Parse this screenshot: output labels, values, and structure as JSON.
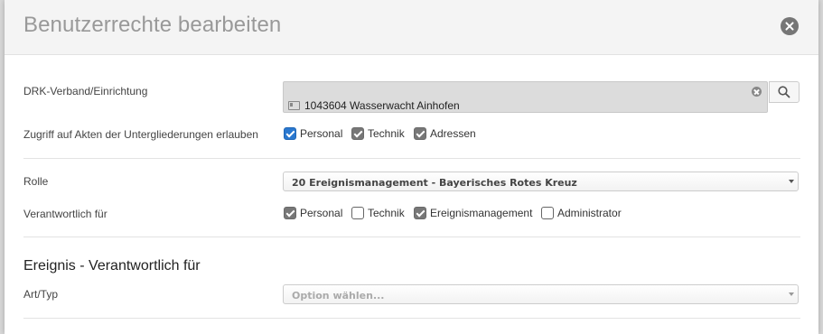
{
  "dialog": {
    "title": "Benutzerrechte bearbeiten"
  },
  "org": {
    "label": "DRK-Verband/Einrichtung",
    "value": "1043604 Wasserwacht Ainhofen"
  },
  "access": {
    "label": "Zugriff auf Akten der Untergliederungen erlauben",
    "options": [
      {
        "label": "Personal",
        "checked": true
      },
      {
        "label": "Technik",
        "checked": true
      },
      {
        "label": "Adressen",
        "checked": true
      }
    ]
  },
  "role": {
    "label": "Rolle",
    "value": "20 Ereignismanagement - Bayerisches Rotes Kreuz"
  },
  "responsible": {
    "label": "Verantwortlich für",
    "options": [
      {
        "label": "Personal",
        "checked": true
      },
      {
        "label": "Technik",
        "checked": false
      },
      {
        "label": "Ereignismanagement",
        "checked": true
      },
      {
        "label": "Administrator",
        "checked": false
      }
    ]
  },
  "event_section": {
    "title": "Ereignis - Verantwortlich für",
    "type_label": "Art/Typ",
    "type_placeholder": "Option wählen..."
  },
  "colors": {
    "primary_checkbox": "#2a78cf",
    "secondary_checkbox": "#777777"
  }
}
